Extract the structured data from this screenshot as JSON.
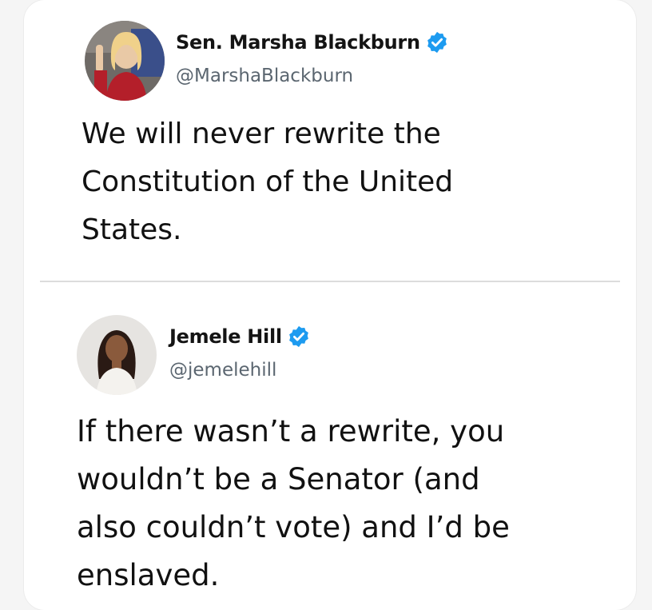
{
  "tweets": [
    {
      "display_name": "Sen. Marsha Blackburn",
      "handle": "@MarshaBlackburn",
      "verified": true,
      "text": "We will never rewrite the\nConstitution of the United\nStates."
    },
    {
      "display_name": "Jemele Hill",
      "handle": "@jemelehill",
      "verified": true,
      "text": "If there wasn’t a rewrite, you\nwouldn’t be a Senator (and\nalso couldn’t vote) and I’d be\nenslaved."
    }
  ],
  "colors": {
    "verified_badge": "#1d9bf0",
    "text": "#111111",
    "handle": "#5b6670",
    "divider": "#dcdcdc"
  },
  "icons": {
    "verified": "verified-badge-icon"
  }
}
